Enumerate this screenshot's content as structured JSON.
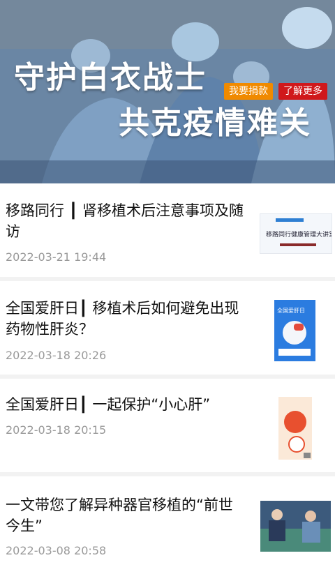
{
  "banner": {
    "slogan_line1": "守护白衣战士",
    "slogan_line2": "共克疫情难关",
    "donate_label": "我要捐款",
    "more_label": "了解更多",
    "donate_color": "#f08a00",
    "more_color": "#d0181b"
  },
  "articles": [
    {
      "title": "移路同行 ┃ 肾移植术后注意事项及随访",
      "date": "2022-03-21 19:44",
      "thumb_text": "移路同行健康管理大讲堂"
    },
    {
      "title": "全国爱肝日┃ 移植术后如何避免出现药物性肝炎？",
      "date": "2022-03-18 20:26",
      "thumb_text": "全国爱肝日"
    },
    {
      "title": "全国爱肝日┃ 一起保护“小心肝”",
      "date": "2022-03-18 20:15"
    },
    {
      "title": "一文带您了解异种器官移植的“前世今生”",
      "date": "2022-03-08 20:58"
    }
  ]
}
